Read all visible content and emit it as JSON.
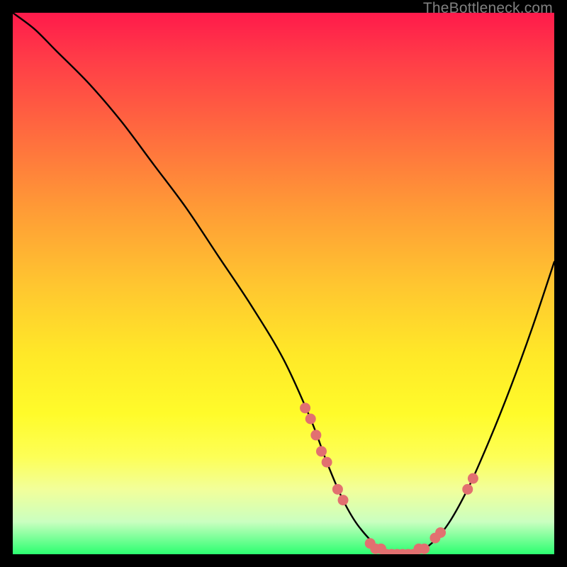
{
  "watermark": "TheBottleneck.com",
  "chart_data": {
    "type": "line",
    "title": "",
    "xlabel": "",
    "ylabel": "",
    "xlim": [
      0,
      100
    ],
    "ylim": [
      0,
      100
    ],
    "grid": false,
    "background_gradient": {
      "direction": "vertical",
      "stops": [
        {
          "pos": 0.0,
          "color": "#ff1a4b"
        },
        {
          "pos": 0.22,
          "color": "#ff6a3f"
        },
        {
          "pos": 0.5,
          "color": "#ffc530"
        },
        {
          "pos": 0.74,
          "color": "#fffb2a"
        },
        {
          "pos": 0.94,
          "color": "#caffc0"
        },
        {
          "pos": 1.0,
          "color": "#2bff70"
        }
      ]
    },
    "series": [
      {
        "name": "bottleneck-curve",
        "color": "#000000",
        "x": [
          0,
          4,
          8,
          14,
          20,
          26,
          32,
          38,
          44,
          50,
          55,
          58,
          61,
          64,
          68,
          72,
          76,
          80,
          84,
          88,
          92,
          96,
          100
        ],
        "y": [
          100,
          97,
          93,
          87,
          80,
          72,
          64,
          55,
          46,
          36,
          25,
          17,
          10,
          5,
          1,
          0,
          1,
          5,
          12,
          21,
          31,
          42,
          54
        ]
      }
    ],
    "markers": {
      "name": "highlight-points",
      "color": "#e27070",
      "shape": "circle",
      "points": [
        {
          "x": 54,
          "y": 27
        },
        {
          "x": 55,
          "y": 25
        },
        {
          "x": 56,
          "y": 22
        },
        {
          "x": 57,
          "y": 19
        },
        {
          "x": 58,
          "y": 17
        },
        {
          "x": 60,
          "y": 12
        },
        {
          "x": 61,
          "y": 10
        },
        {
          "x": 66,
          "y": 2
        },
        {
          "x": 67,
          "y": 1
        },
        {
          "x": 68,
          "y": 1
        },
        {
          "x": 69,
          "y": 0
        },
        {
          "x": 70,
          "y": 0
        },
        {
          "x": 71,
          "y": 0
        },
        {
          "x": 72,
          "y": 0
        },
        {
          "x": 73,
          "y": 0
        },
        {
          "x": 74,
          "y": 0
        },
        {
          "x": 75,
          "y": 1
        },
        {
          "x": 76,
          "y": 1
        },
        {
          "x": 78,
          "y": 3
        },
        {
          "x": 79,
          "y": 4
        },
        {
          "x": 84,
          "y": 12
        },
        {
          "x": 85,
          "y": 14
        }
      ]
    }
  }
}
